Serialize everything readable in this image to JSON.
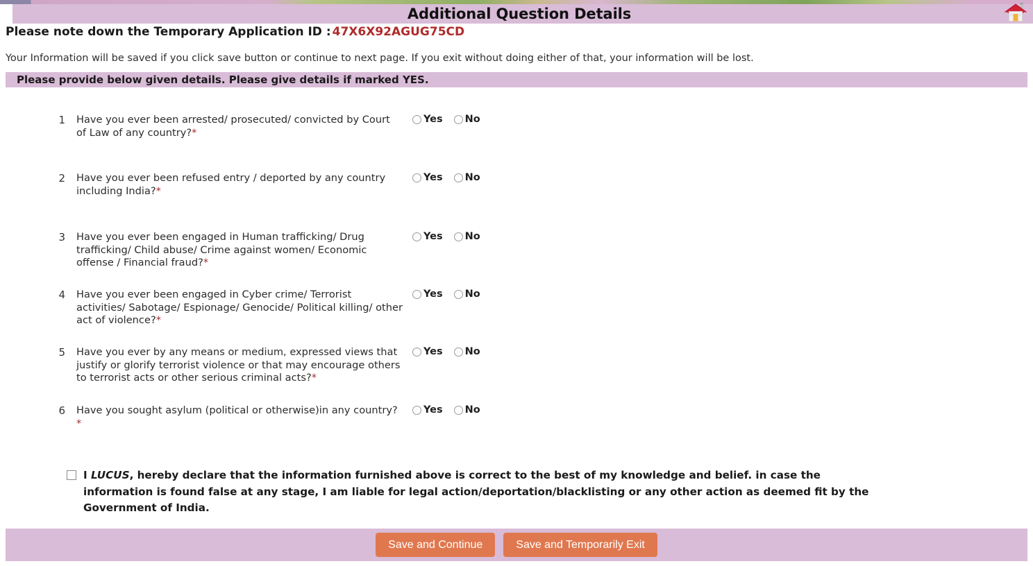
{
  "header": {
    "title": "Additional Question Details",
    "home_icon": "home-icon"
  },
  "app_id": {
    "label": "Please note down the Temporary Application ID :",
    "value": "47X6X92AGUG75CD"
  },
  "info_note": "Your Information will be saved if you click save button or continue to next page. If you exit without doing either of that, your information will be lost.",
  "section_band": "Please provide below given details. Please give details if marked YES.",
  "options": {
    "yes": "Yes",
    "no": "No"
  },
  "questions": [
    {
      "number": "1",
      "text": "Have you ever been arrested/ prosecuted/ convicted by Court of Law of any country?",
      "required_mark": "*",
      "selected": ""
    },
    {
      "number": "2",
      "text": "Have you ever been refused entry / deported by any country including India?",
      "required_mark": "*",
      "selected": ""
    },
    {
      "number": "3",
      "text": "Have you ever been engaged in Human trafficking/ Drug trafficking/ Child abuse/ Crime against women/ Economic offense / Financial fraud?",
      "required_mark": "*",
      "selected": ""
    },
    {
      "number": "4",
      "text": "Have you ever been engaged in Cyber crime/ Terrorist activities/ Sabotage/ Espionage/ Genocide/ Political killing/ other act of violence?",
      "required_mark": "*",
      "selected": ""
    },
    {
      "number": "5",
      "text": "Have you ever by any means or medium, expressed views that justify or glorify terrorist violence or that may encourage others to terrorist acts or other serious criminal acts?",
      "required_mark": "*",
      "selected": ""
    },
    {
      "number": "6",
      "text": "Have you sought asylum (political or otherwise)in any country?",
      "required_mark": "*",
      "selected": ""
    }
  ],
  "declaration": {
    "checked": false,
    "prefix": "I ",
    "name": "LUCUS",
    "body": ", hereby declare that the information furnished above is correct to the best of my knowledge and belief. in case the information is found false at any stage, I am liable for legal action/deportation/blacklisting or any other action as deemed fit by the Government of India."
  },
  "footer": {
    "save_continue_label": "Save and Continue",
    "save_exit_label": "Save and Temporarily Exit"
  },
  "colors": {
    "band": "#d9bcd8",
    "button": "#e0784f",
    "app_id": "#b02b2b",
    "required_star": "#a03030"
  }
}
